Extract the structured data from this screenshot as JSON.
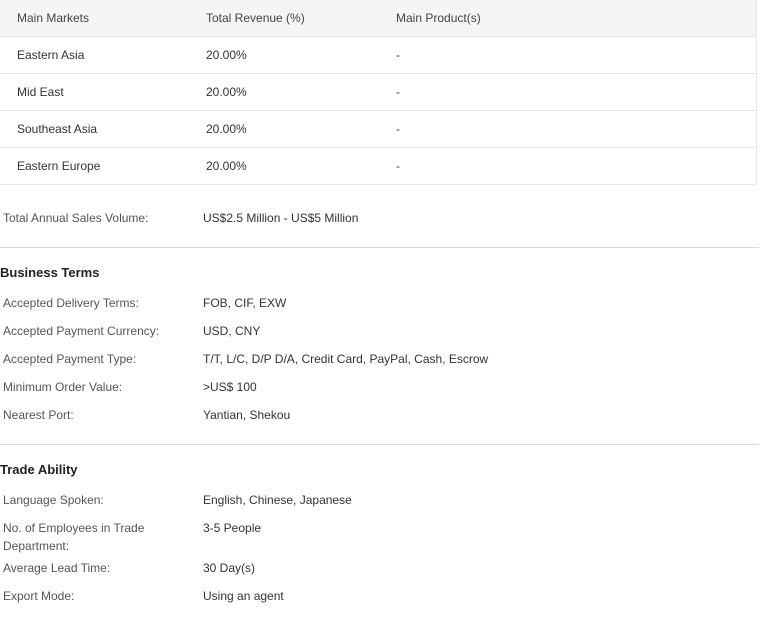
{
  "markets": {
    "headers": [
      "Main Markets",
      "Total Revenue (%)",
      "Main Product(s)"
    ],
    "rows": [
      {
        "market": "Eastern Asia",
        "revenue": "20.00%",
        "product": "-"
      },
      {
        "market": "Mid East",
        "revenue": "20.00%",
        "product": "-"
      },
      {
        "market": "Southeast Asia",
        "revenue": "20.00%",
        "product": "-"
      },
      {
        "market": "Eastern Europe",
        "revenue": "20.00%",
        "product": "-"
      }
    ]
  },
  "sales": {
    "label": "Total Annual Sales Volume:",
    "value": "US$2.5 Million - US$5 Million"
  },
  "business_terms": {
    "title": "Business Terms",
    "items": [
      {
        "label": "Accepted Delivery Terms:",
        "value": "FOB, CIF, EXW"
      },
      {
        "label": "Accepted Payment Currency:",
        "value": "USD, CNY"
      },
      {
        "label": "Accepted Payment Type:",
        "value": "T/T, L/C, D/P D/A, Credit Card, PayPal, Cash, Escrow"
      },
      {
        "label": "Minimum Order Value:",
        "value": ">US$ 100"
      },
      {
        "label": "Nearest Port:",
        "value": "Yantian, Shekou"
      }
    ]
  },
  "trade_ability": {
    "title": "Trade Ability",
    "items": [
      {
        "label": "Language Spoken:",
        "value": "English, Chinese, Japanese"
      },
      {
        "label": "No. of Employees in Trade Department:",
        "value": "3-5 People"
      },
      {
        "label": "Average Lead Time:",
        "value": "30 Day(s)"
      },
      {
        "label": "Export Mode:",
        "value": "Using an agent"
      }
    ]
  }
}
